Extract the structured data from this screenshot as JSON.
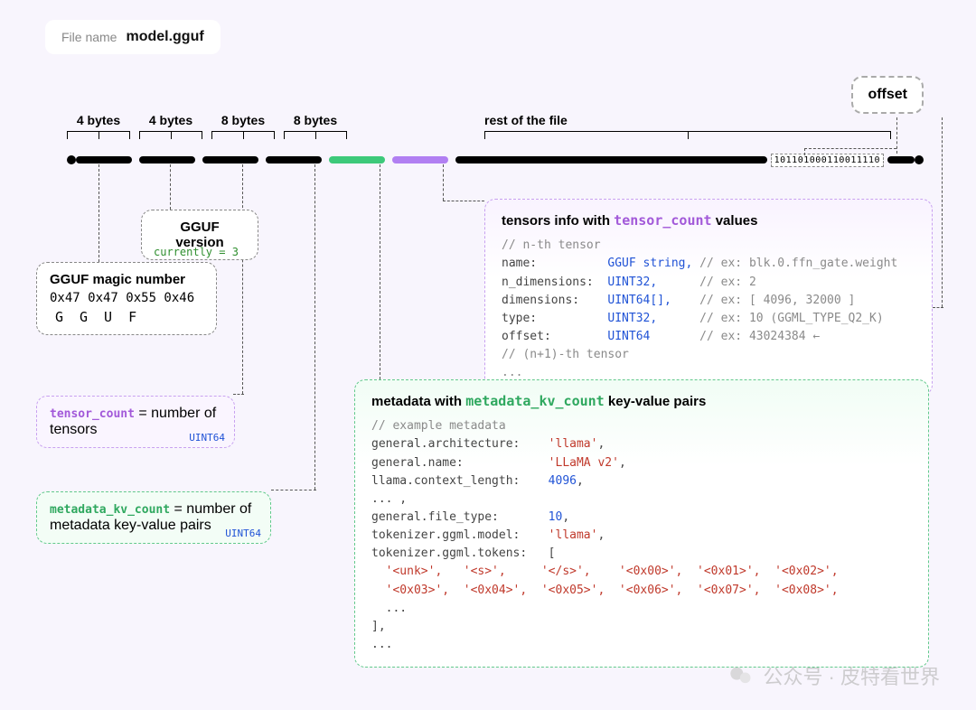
{
  "file": {
    "label": "File name",
    "value": "model.gguf"
  },
  "offset_label": "offset",
  "sizes": {
    "s1": "4 bytes",
    "s2": "4 bytes",
    "s3": "8 bytes",
    "s4": "8 bytes",
    "rest": "rest of the file"
  },
  "binary_sample": "101101000110011110",
  "gguf_version": {
    "title": "GGUF version",
    "note": "currently = 3"
  },
  "magic": {
    "title": "GGUF magic number",
    "hex": "0x47 0x47 0x55 0x46",
    "letters": "GGUF"
  },
  "tensor_count_box": {
    "kw": "tensor_count",
    "rest": " = number of tensors",
    "type": "UINT64"
  },
  "meta_count_box": {
    "kw": "metadata_kv_count",
    "rest": " = number of metadata key-value pairs",
    "type": "UINT64"
  },
  "tensors_panel": {
    "heading_pre": "tensors info with ",
    "heading_kw": "tensor_count",
    "heading_post": " values",
    "c1": "// n-th tensor",
    "rows": [
      {
        "k": "name:",
        "t": "GGUF string,",
        "c": "// ex: blk.0.ffn_gate.weight"
      },
      {
        "k": "n_dimensions:",
        "t": "UINT32,",
        "c": "// ex: 2"
      },
      {
        "k": "dimensions:",
        "t": "UINT64[],",
        "c": "// ex: [ 4096, 32000 ]"
      },
      {
        "k": "type:",
        "t": "UINT32,",
        "c": "// ex: 10 (GGML_TYPE_Q2_K)"
      },
      {
        "k": "offset:",
        "t": "UINT64",
        "c": "// ex: 43024384 ←"
      }
    ],
    "c2": "// (n+1)-th tensor",
    "dots": "..."
  },
  "meta_panel": {
    "heading_pre": "metadata with ",
    "heading_kw": "metadata_kv_count",
    "heading_post": " key-value pairs",
    "c1": "// example metadata",
    "lines": [
      {
        "k": "general.architecture:",
        "v": "'llama'",
        "comma": ","
      },
      {
        "k": "general.name:",
        "v": "'LLaMA v2'",
        "comma": ","
      },
      {
        "k": "llama.context_length:",
        "v": "4096",
        "comma": ",",
        "vtype": "kw"
      },
      {
        "k": "... ,",
        "v": "",
        "comma": ""
      },
      {
        "k": "general.file_type:",
        "v": "10",
        "comma": ",",
        "vtype": "kw"
      },
      {
        "k": "tokenizer.ggml.model:",
        "v": "'llama'",
        "comma": ","
      },
      {
        "k": "tokenizer.ggml.tokens:",
        "v": "[",
        "comma": "",
        "vtype": "plain"
      }
    ],
    "tokens1": "  '<unk>',   '<s>',     '</s>',    '<0x00>',  '<0x01>',  '<0x02>',",
    "tokens2": "  '<0x03>',  '<0x04>',  '<0x05>',  '<0x06>',  '<0x07>',  '<0x08>',",
    "tokens3": "  ...",
    "close": "],",
    "dots": "..."
  },
  "watermark": "公众号 · 皮特看世界"
}
